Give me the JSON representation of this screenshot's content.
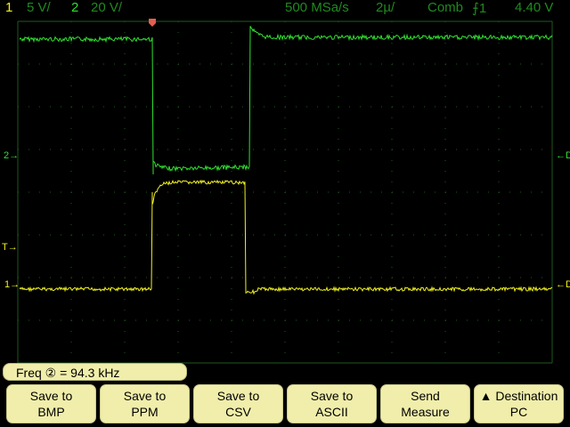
{
  "status_bar": {
    "ch1_label": "1",
    "ch1_scale": "5 V/",
    "ch2_label": "2",
    "ch2_scale": "20 V/",
    "sample_rate": "500 MSa/s",
    "timebase": "2µ/",
    "mode": "Comb",
    "trigger": "⨍1",
    "trigger_level": "4.40 V"
  },
  "markers": {
    "ch1": "1",
    "ch2": "2",
    "trigger": "T",
    "coupling_ch1": "DC",
    "coupling_ch2": "DC"
  },
  "measurement": "Freq ② = 94.3 kHz",
  "softkeys": [
    {
      "line1": "Save to",
      "line2": "BMP"
    },
    {
      "line1": "Save to",
      "line2": "PPM"
    },
    {
      "line1": "Save to",
      "line2": "CSV"
    },
    {
      "line1": "Save to",
      "line2": "ASCII"
    },
    {
      "line1": "Send",
      "line2": "Measure"
    },
    {
      "line1": "▲ Destination",
      "line2": "PC"
    }
  ],
  "colors": {
    "ch1": "#f0f020",
    "ch2": "#30e030",
    "grid": "#1e5a1e",
    "softkey": "#f0eeaa",
    "trigger_marker": "#e06050"
  }
}
